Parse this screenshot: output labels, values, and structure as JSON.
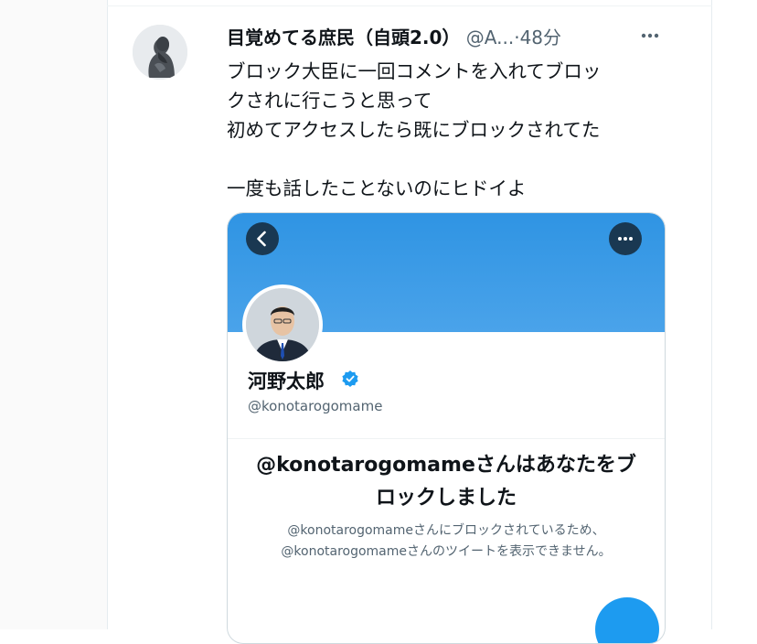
{
  "tweet": {
    "display_name": "目覚めてる庶民（自頭2.0）",
    "handle": "@A...",
    "dot": "·",
    "time": "48分",
    "text": "ブロック大臣に一回コメントを入れてブロッ\nクされに行こうと思って\n初めてアクセスしたら既にブロックされてた\n\n一度も話したことないのにヒドイよ"
  },
  "card": {
    "profile_name": "河野太郎",
    "profile_handle": "@konotarogomame",
    "blocked_title": "@konotarogomameさんはあなたをブ\nロックしました",
    "blocked_desc": "@konotarogomameさんにブロックされているため、\n@konotarogomameさんのツイートを表示できません。"
  },
  "icons": {
    "more": "more-horizontal-icon",
    "back": "chevron-left-icon",
    "card_more": "more-horizontal-icon",
    "verified": "verified-badge-icon"
  },
  "colors": {
    "accent": "#1d9bf0",
    "banner": "#2f94e3",
    "text": "#0f1419",
    "secondary": "#536471"
  }
}
